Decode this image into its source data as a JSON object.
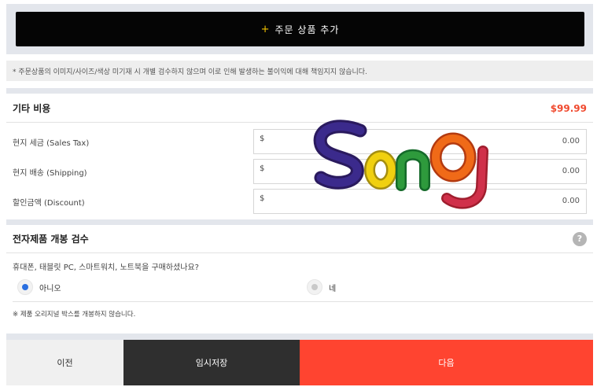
{
  "add_button": {
    "plus": "+",
    "label": "주문 상품 추가"
  },
  "notice": "* 주문상품의 이미지/사이즈/색상 미기재 시 개별 검수하지 않으며 이로 인해 발생하는 불이익에 대해 책임지지 않습니다.",
  "costs": {
    "title": "기타 비용",
    "total": "$99.99",
    "rows": [
      {
        "label": "현지 세금 (Sales Tax)",
        "currency": "$",
        "value": "0.00"
      },
      {
        "label": "현지 배송 (Shipping)",
        "currency": "$",
        "value": "0.00"
      },
      {
        "label": "할인금액 (Discount)",
        "currency": "$",
        "value": "0.00"
      }
    ]
  },
  "stamp": {
    "text": "Song"
  },
  "inspection": {
    "title": "전자제품 개봉 검수",
    "help": "?",
    "question": "휴대폰, 태블릿 PC, 스마트워치, 노트북을 구매하셨나요?",
    "options": {
      "no": "아니오",
      "yes": "네"
    },
    "selected": "no",
    "footnote": "※ 제품 오리지널 박스를 개봉하지 않습니다."
  },
  "nav": {
    "prev": "이전",
    "save": "임시저장",
    "next": "다음"
  },
  "colors": {
    "accent": "#ff4430",
    "total": "#f04a2f",
    "radio_on": "#2a6fe0"
  }
}
